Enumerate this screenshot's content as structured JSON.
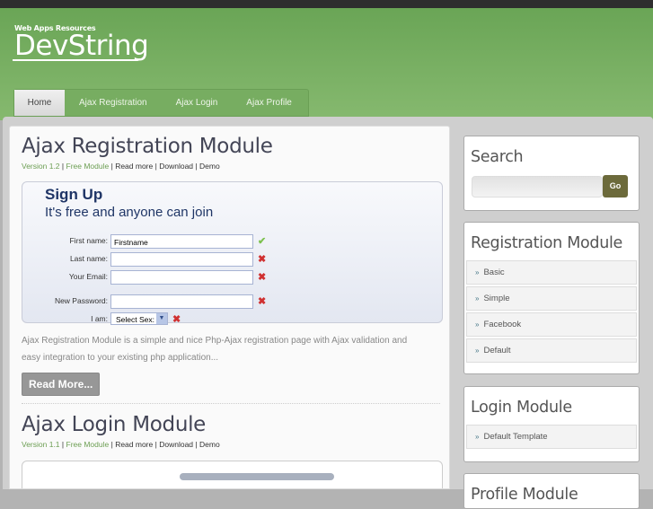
{
  "logo": {
    "tagline": "Web Apps Resources",
    "name": "DevString"
  },
  "nav": [
    {
      "label": "Home",
      "active": true
    },
    {
      "label": "Ajax Registration"
    },
    {
      "label": "Ajax Login"
    },
    {
      "label": "Ajax Profile"
    }
  ],
  "posts": [
    {
      "title": "Ajax Registration Module",
      "version": "Version 1.2",
      "free": "Free Module",
      "read": "Read more",
      "download": "Download",
      "demo": "Demo",
      "form": {
        "title": "Sign Up",
        "subtitle": "It's free and anyone can join",
        "fields": [
          {
            "label": "First name:",
            "value": "Firstname",
            "status": "✔"
          },
          {
            "label": "Last name:",
            "value": "",
            "status": "✖"
          },
          {
            "label": "Your Email:",
            "value": "",
            "status": "✖"
          },
          {
            "label": "New Password:",
            "value": "",
            "status": "✖"
          }
        ],
        "sex_label": "I am:",
        "sex_value": "Select Sex:",
        "sex_status": "✖"
      },
      "description": "Ajax Registration Module is a simple and nice Php-Ajax registration page with Ajax validation and easy integration to your existing php application...",
      "button": "Read More..."
    },
    {
      "title": "Ajax Login Module",
      "version": "Version 1.1",
      "free": "Free Module",
      "read": "Read more",
      "download": "Download",
      "demo": "Demo"
    }
  ],
  "sep": "|",
  "sidebar": {
    "search": {
      "title": "Search",
      "go": "Go"
    },
    "registration": {
      "title": "Registration Module",
      "items": [
        "Basic",
        "Simple",
        "Facebook",
        "Default"
      ]
    },
    "login": {
      "title": "Login Module",
      "items": [
        "Default Template"
      ]
    },
    "profile": {
      "title": "Profile Module"
    },
    "bullet": "»"
  }
}
